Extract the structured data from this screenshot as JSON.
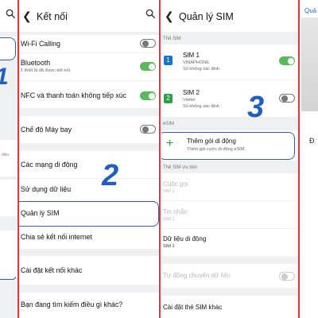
{
  "p0": {
    "search_icon": "search-icon",
    "step_number": "1",
    "faint_text": "điệu"
  },
  "p1": {
    "title": "Kết nối",
    "items": [
      {
        "label": "Wi-Fi Calling"
      },
      {
        "label": "Bluetooth",
        "sub": "1 thiết bị đã được kết nối."
      },
      {
        "label": "NFC và thanh toán không tiếp xúc"
      },
      {
        "label": "Chế độ Máy bay"
      },
      {
        "label": "Các mạng di động"
      },
      {
        "label": "Sử dụng dữ liệu"
      },
      {
        "label": "Quản lý SIM"
      },
      {
        "label": "Chia sẻ kết nối internet"
      },
      {
        "label": "Cài đặt kết nối khác"
      }
    ],
    "footer": "Bạn đang tìm kiếm điều gì khác?",
    "step_number": "2"
  },
  "p2": {
    "title": "Quản lý SIM",
    "section_sim": "Thẻ SIM",
    "sim1": {
      "badge": "1",
      "name": "SIM 1",
      "carrier": "VINAPHONE",
      "number": "Số không xác định",
      "color": "#1a73c7"
    },
    "sim2": {
      "badge": "2",
      "name": "SIM 2",
      "carrier": "Viettel",
      "number": "Số không xác định",
      "color": "#2e9e48"
    },
    "section_esim": "eSIM",
    "add_plan": {
      "icon": "+",
      "title": "Thêm gói di động",
      "sub": "Thêm gói cước di động eSIM."
    },
    "section_pref": "Thẻ SIM ưu tiên",
    "pref_items": [
      {
        "label": "Cuộc gọi",
        "sub": "SIM 1"
      },
      {
        "label": "Tin nhắn",
        "sub": "SIM 1"
      },
      {
        "label": "Dữ liệu di động",
        "sub": "SIM 1"
      }
    ],
    "auto_switch": "Tự động chuyển dữ liệu",
    "more_settings": "Cài đặt thẻ SIM khác",
    "step_number": "3"
  },
  "p3": {
    "title_partial": "Quả",
    "text_partial": "Đ"
  }
}
